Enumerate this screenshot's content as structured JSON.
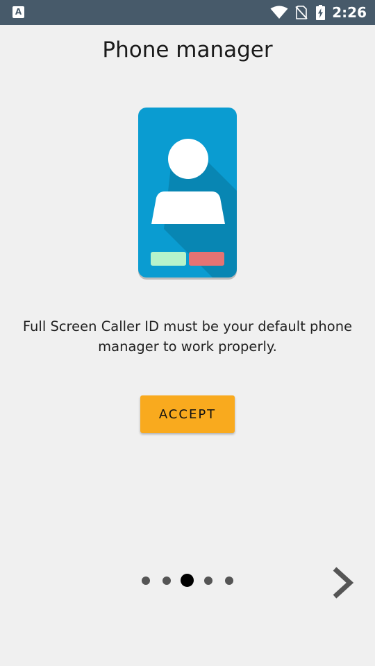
{
  "status_bar": {
    "app_icon_letter": "A",
    "time": "2:26",
    "icons": [
      "app-notification-icon",
      "wifi-icon",
      "no-sim-icon",
      "battery-charging-icon"
    ],
    "background": "#475a6a"
  },
  "page": {
    "title": "Phone manager",
    "description": "Full Screen Caller ID must be your default phone manager to work properly.",
    "accept_label": "ACCEPT",
    "illustration_icon": "phone-contact-illustration"
  },
  "pager": {
    "count": 5,
    "active_index": 2
  },
  "colors": {
    "background": "#f0f0f0",
    "accent": "#f9aa1e",
    "phone_blue": "#0a9cd1",
    "answer_green": "#b6f3cb",
    "decline_red": "#e57373"
  },
  "navigation": {
    "next_icon": "chevron-right-icon"
  }
}
